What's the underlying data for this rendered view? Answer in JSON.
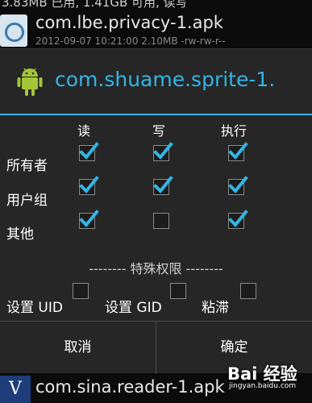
{
  "background": {
    "status_text": "3.83MB 已用, 1.41GB 可用, 读写",
    "top_row": {
      "title": "com.lbe.privacy-1.apk",
      "subtitle": "2012-09-07 10:21:00  2.10MB  -rw-rw-r--"
    },
    "bottom_row": {
      "icon_letter": "V",
      "title": "com.sina.reader-1.apk"
    }
  },
  "dialog": {
    "title": "com.shuame.sprite-1.",
    "columns": [
      "读",
      "写",
      "执行"
    ],
    "rows": [
      {
        "label": "所有者",
        "checks": [
          true,
          true,
          true
        ]
      },
      {
        "label": "用户组",
        "checks": [
          true,
          true,
          true
        ]
      },
      {
        "label": "其他",
        "checks": [
          true,
          false,
          true
        ]
      }
    ],
    "special_section": "-------- 特殊权限 --------",
    "special_options": [
      {
        "label": "设置 UID",
        "checked": false
      },
      {
        "label": "设置 GID",
        "checked": false
      },
      {
        "label": "粘滞",
        "checked": false
      }
    ],
    "buttons": {
      "cancel": "取消",
      "ok": "确定"
    }
  },
  "watermark": {
    "logo": "Bai 经验",
    "url": "jingyan.baidu.com"
  },
  "colors": {
    "accent": "#33b5e5",
    "check": "#33b5e5",
    "dialog_bg": "#262626",
    "android_green": "#a4c639"
  }
}
